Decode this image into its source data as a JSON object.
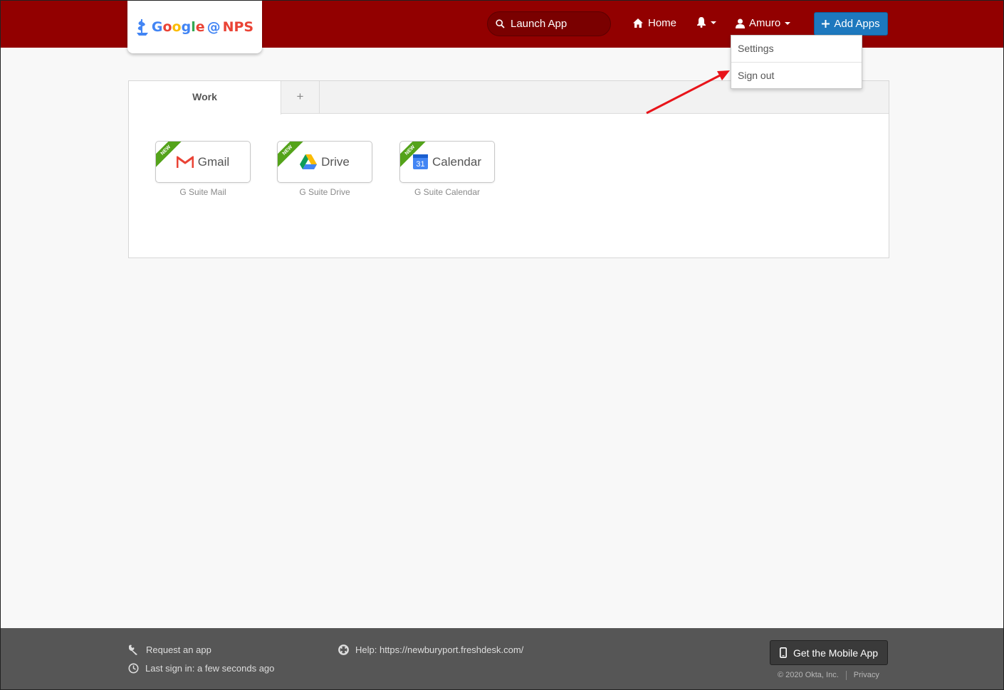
{
  "header": {
    "logo": {
      "google_letters": [
        "G",
        "o",
        "o",
        "g",
        "l",
        "e"
      ],
      "at": "@",
      "org": "NPS"
    },
    "search": {
      "placeholder": "Launch App"
    },
    "home_label": "Home",
    "user_label": "Amuro",
    "add_apps_label": "Add Apps",
    "accent_color": "#920000",
    "button_color": "#1d78be"
  },
  "user_menu": {
    "items": [
      {
        "label": "Settings"
      },
      {
        "label": "Sign out"
      }
    ]
  },
  "tabs": {
    "work_label": "Work",
    "add_label": "+"
  },
  "apps": [
    {
      "name": "Gmail",
      "subtitle": "G Suite Mail",
      "badge": "NEW",
      "icon": "gmail-icon"
    },
    {
      "name": "Drive",
      "subtitle": "G Suite Drive",
      "badge": "NEW",
      "icon": "drive-icon"
    },
    {
      "name": "Calendar",
      "subtitle": "G Suite Calendar",
      "badge": "NEW",
      "icon": "calendar-icon",
      "icon_text": "31"
    }
  ],
  "footer": {
    "request_app": "Request an app",
    "last_sign_in": "Last sign in: a few seconds ago",
    "help": "Help: https://newburyport.freshdesk.com/",
    "mobile_app": "Get the Mobile App",
    "copyright": "© 2020 Okta, Inc.",
    "privacy": "Privacy"
  }
}
